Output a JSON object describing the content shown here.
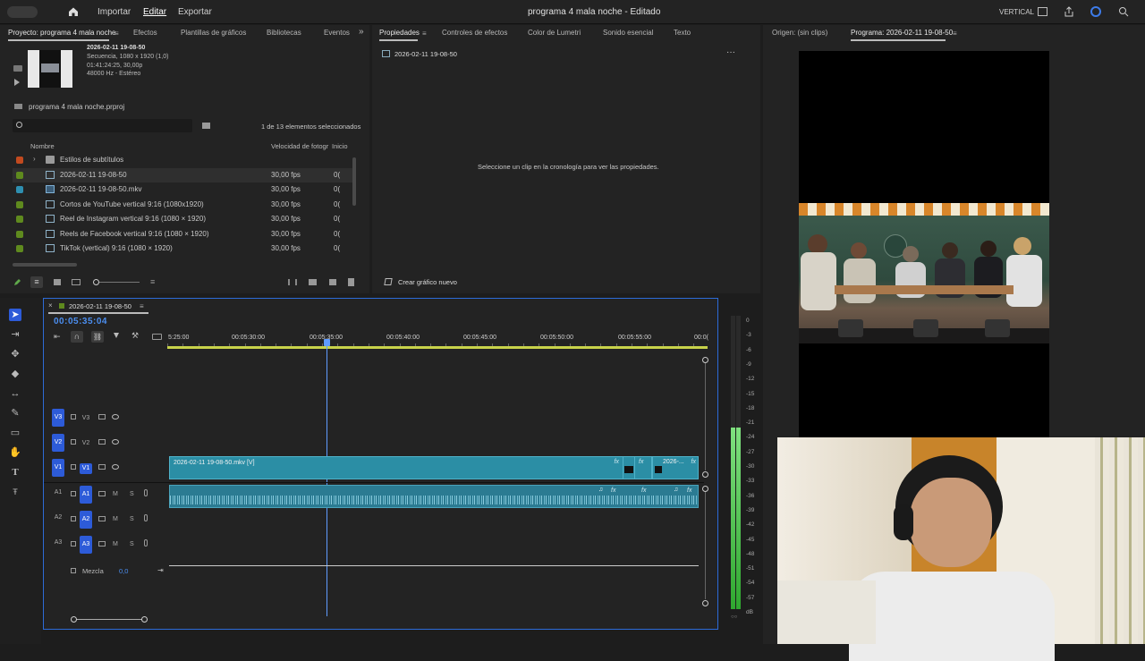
{
  "topbar": {
    "home_icon": "home-icon",
    "menu_import": "Importar",
    "menu_edit": "Editar",
    "menu_export": "Exportar",
    "title": "programa 4 mala noche - Editado",
    "workspace": "VERTICAL"
  },
  "project_panel": {
    "tab_project": "Proyecto: programa 4 mala noche",
    "tab_effects": "Efectos",
    "tab_templates": "Plantillas de gráficos",
    "tab_libraries": "Bibliotecas",
    "tab_events": "Eventos",
    "preview_name": "2026-02-11 19-08-50",
    "preview_line1": "Secuencia, 1080 x 1920 (1,0)",
    "preview_line2": "01:41:24:25, 30,00p",
    "preview_line3": "48000 Hz - Estéreo",
    "project_file": "programa 4 mala noche.prproj",
    "search_placeholder": "",
    "selection_count": "1 de 13 elementos seleccionados",
    "col_name": "Nombre",
    "col_fps": "Velocidad de fotogr",
    "col_start": "Inicio",
    "items": [
      {
        "name": "Estilos de subtítulos",
        "fps": "",
        "start": "",
        "color": "#c24a1f",
        "type": "folder"
      },
      {
        "name": "2026-02-11 19-08-50",
        "fps": "30,00 fps",
        "start": "0(",
        "color": "#5f8a1e",
        "type": "sequence"
      },
      {
        "name": "2026-02-11 19-08-50.mkv",
        "fps": "30,00 fps",
        "start": "0(",
        "color": "#2e8fb0",
        "type": "clip"
      },
      {
        "name": "Cortos de YouTube vertical 9:16 (1080x1920)",
        "fps": "30,00 fps",
        "start": "0(",
        "color": "#5f8a1e",
        "type": "sequence"
      },
      {
        "name": "Reel de Instagram vertical 9:16 (1080 × 1920)",
        "fps": "30,00 fps",
        "start": "0(",
        "color": "#5f8a1e",
        "type": "sequence"
      },
      {
        "name": "Reels de Facebook vertical 9:16 (1080 × 1920)",
        "fps": "30,00 fps",
        "start": "0(",
        "color": "#5f8a1e",
        "type": "sequence"
      },
      {
        "name": "TikTok (vertical) 9:16 (1080 × 1920)",
        "fps": "30,00 fps",
        "start": "0(",
        "color": "#5f8a1e",
        "type": "sequence"
      }
    ]
  },
  "properties_panel": {
    "tab_properties": "Propiedades",
    "tab_effect_controls": "Controles de efectos",
    "tab_lumetri": "Color de Lumetri",
    "tab_audio": "Sonido esencial",
    "tab_text": "Texto",
    "sequence_name": "2026-02-11 19-08-50",
    "empty_message": "Seleccione un clip en la cronología para ver las propiedades.",
    "new_graphic": "Crear gráfico nuevo"
  },
  "monitor": {
    "tab_source": "Origen: (sin clips)",
    "tab_program": "Programa: 2026-02-11 19-08-50"
  },
  "timeline": {
    "tab_name": "2026-02-11 19-08-50",
    "timecode": "00:05:35:04",
    "ruler": [
      "5:25:00",
      "00:05:30:00",
      "00:05:35:00",
      "00:05:40:00",
      "00:05:45:00",
      "00:05:50:00",
      "00:05:55:00",
      "00:0("
    ],
    "tracks_video": [
      {
        "label": "V3",
        "name": "V3"
      },
      {
        "label": "V2",
        "name": "V2"
      },
      {
        "label": "V1",
        "name": "V1"
      }
    ],
    "tracks_audio": [
      {
        "label": "A1",
        "name": "A1"
      },
      {
        "label": "A2",
        "name": "A2"
      },
      {
        "label": "A3",
        "name": "A3"
      }
    ],
    "mix_label": "Mezcla",
    "mix_value": "0,0",
    "clip_video_name": "2026-02-11 19-08-50.mkv [V]",
    "clip_video_name2": "2026-...",
    "fx": "fx",
    "mute": "M",
    "solo": "S"
  },
  "meter": {
    "ticks": [
      "0",
      "-3",
      "-6",
      "-9",
      "-12",
      "-15",
      "-18",
      "-21",
      "-24",
      "-27",
      "-30",
      "-33",
      "-36",
      "-39",
      "-42",
      "-45",
      "-48",
      "-51",
      "-54",
      "-57",
      "dB"
    ],
    "level": 0.62
  },
  "colors": {
    "accent": "#2d5bd8",
    "clip_video": "#2b8ea5",
    "clip_audio": "#2b7b92",
    "meter_green": "#3cc43c"
  }
}
